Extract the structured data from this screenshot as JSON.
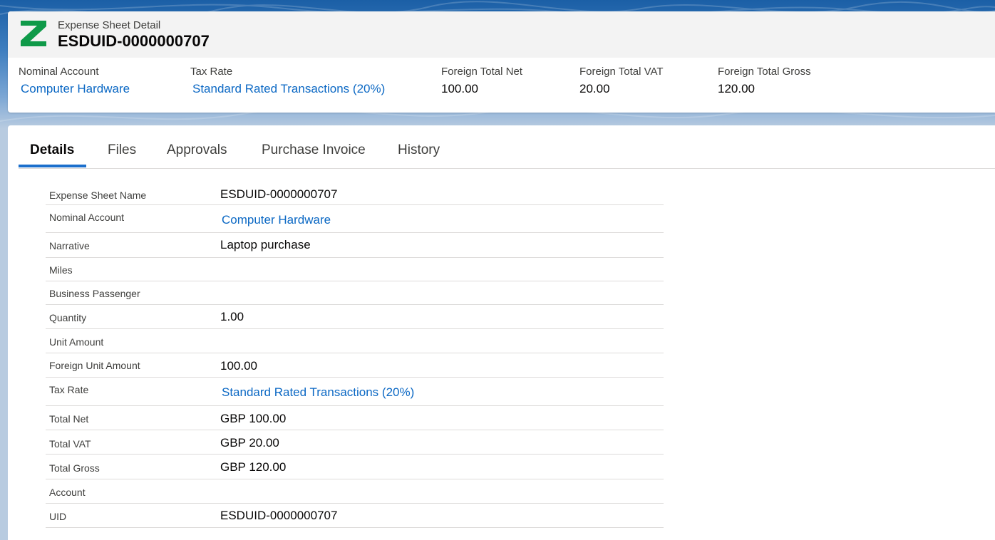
{
  "header": {
    "subtitle": "Expense Sheet Detail",
    "title": "ESDUID-0000000707",
    "fields": [
      {
        "label": "Nominal Account",
        "value": "Computer Hardware",
        "link": true
      },
      {
        "label": "Tax Rate",
        "value": "Standard Rated Transactions (20%)",
        "link": true
      },
      {
        "label": "Foreign Total Net",
        "value": "100.00",
        "link": false
      },
      {
        "label": "Foreign Total VAT",
        "value": "20.00",
        "link": false
      },
      {
        "label": "Foreign Total Gross",
        "value": "120.00",
        "link": false
      }
    ]
  },
  "logo": {
    "icon": "z-logo-icon",
    "color": "#0f9a49"
  },
  "tabs": [
    {
      "label": "Details",
      "active": true
    },
    {
      "label": "Files",
      "active": false
    },
    {
      "label": "Approvals",
      "active": false
    },
    {
      "label": "Purchase Invoice",
      "active": false
    },
    {
      "label": "History",
      "active": false
    }
  ],
  "details": [
    {
      "label": "Expense Sheet Name",
      "value": "ESDUID-0000000707",
      "link": false
    },
    {
      "label": "Nominal Account",
      "value": "Computer Hardware",
      "link": true
    },
    {
      "label": "Narrative",
      "value": "Laptop purchase",
      "link": false
    },
    {
      "label": "Miles",
      "value": "",
      "link": false
    },
    {
      "label": "Business Passenger",
      "value": "",
      "link": false
    },
    {
      "label": "Quantity",
      "value": "1.00",
      "link": false
    },
    {
      "label": "Unit Amount",
      "value": "",
      "link": false
    },
    {
      "label": "Foreign Unit Amount",
      "value": "100.00",
      "link": false
    },
    {
      "label": "Tax Rate",
      "value": "Standard Rated Transactions (20%)",
      "link": true
    },
    {
      "label": "Total Net",
      "value": "GBP 100.00",
      "link": false
    },
    {
      "label": "Total VAT",
      "value": "GBP 20.00",
      "link": false
    },
    {
      "label": "Total Gross",
      "value": "GBP 120.00",
      "link": false
    },
    {
      "label": "Account",
      "value": "",
      "link": false
    },
    {
      "label": "UID",
      "value": "ESDUID-0000000707",
      "link": false
    }
  ],
  "colors": {
    "link": "#0b68c4",
    "accent": "#1b6fcc",
    "brand": "#0f9a49"
  }
}
